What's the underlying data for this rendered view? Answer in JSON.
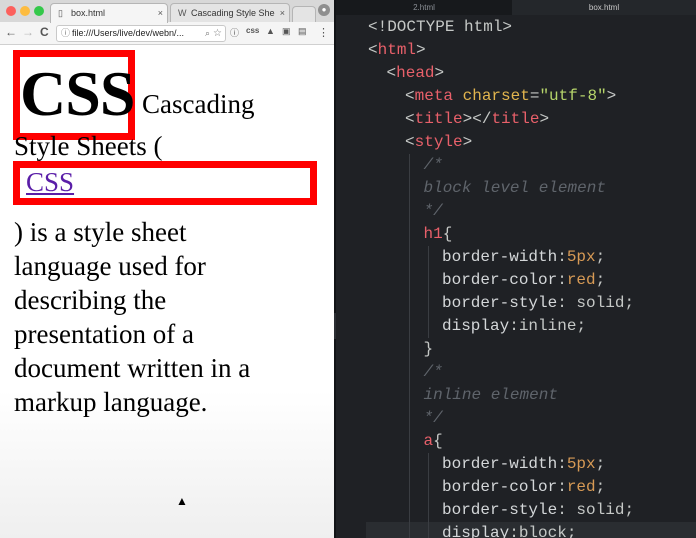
{
  "browser": {
    "tabs": [
      {
        "title": "box.html",
        "icon": "page-icon",
        "active": true
      },
      {
        "title": "Cascading Style Sheets",
        "icon": "wikipedia-icon",
        "active": false
      }
    ],
    "tab_close": "×",
    "url": "file:///Users/live/dev/webn/...",
    "nav": {
      "back": "←",
      "forward": "→",
      "reload": "C"
    },
    "extensions": {
      "info": "ⓘ",
      "css": "css",
      "ext3": "▲",
      "ext4": "▣",
      "ext5": "▤",
      "menu": "⋮"
    }
  },
  "page": {
    "h1": "CSS",
    "line1": "Cascading",
    "line2": "Style Sheets (",
    "link": "CSS",
    "lines": [
      ") is a style sheet",
      "language used for",
      "describing the",
      "presentation of a",
      "document written in a",
      "markup language."
    ]
  },
  "editor": {
    "tabs": [
      "2.html",
      "box.html"
    ],
    "collapse": "›",
    "lines": [
      {
        "indent": 0,
        "tokens": [
          [
            "punc",
            "<!DOCTYPE html>"
          ]
        ]
      },
      {
        "indent": 0,
        "tokens": [
          [
            "punc",
            "<"
          ],
          [
            "tag",
            "html"
          ],
          [
            "punc",
            ">"
          ]
        ]
      },
      {
        "indent": 1,
        "tokens": [
          [
            "punc",
            "<"
          ],
          [
            "tag",
            "head"
          ],
          [
            "punc",
            ">"
          ]
        ]
      },
      {
        "indent": 2,
        "tokens": [
          [
            "punc",
            "<"
          ],
          [
            "tag",
            "meta"
          ],
          [
            "plain",
            " "
          ],
          [
            "attr",
            "charset"
          ],
          [
            "punc",
            "="
          ],
          [
            "str",
            "\"utf-8\""
          ],
          [
            "punc",
            ">"
          ]
        ]
      },
      {
        "indent": 2,
        "tokens": [
          [
            "punc",
            "<"
          ],
          [
            "tag",
            "title"
          ],
          [
            "punc",
            "></"
          ],
          [
            "tag",
            "title"
          ],
          [
            "punc",
            ">"
          ]
        ]
      },
      {
        "indent": 2,
        "tokens": [
          [
            "punc",
            "<"
          ],
          [
            "tag",
            "style"
          ],
          [
            "punc",
            ">"
          ]
        ]
      },
      {
        "indent": 3,
        "tokens": [
          [
            "com",
            "/*"
          ]
        ]
      },
      {
        "indent": 3,
        "tokens": [
          [
            "com",
            "block level element"
          ]
        ]
      },
      {
        "indent": 3,
        "tokens": [
          [
            "com",
            "*/"
          ]
        ]
      },
      {
        "indent": 3,
        "tokens": [
          [
            "sel",
            "h1"
          ],
          [
            "punc",
            "{"
          ]
        ]
      },
      {
        "indent": 4,
        "tokens": [
          [
            "prop",
            "border-width"
          ],
          [
            "punc",
            ":"
          ],
          [
            "val",
            "5px"
          ],
          [
            "punc",
            ";"
          ]
        ]
      },
      {
        "indent": 4,
        "tokens": [
          [
            "prop",
            "border-color"
          ],
          [
            "punc",
            ":"
          ],
          [
            "val",
            "red"
          ],
          [
            "punc",
            ";"
          ]
        ]
      },
      {
        "indent": 4,
        "tokens": [
          [
            "prop",
            "border-style"
          ],
          [
            "punc",
            ": "
          ],
          [
            "plain",
            "solid"
          ],
          [
            "punc",
            ";"
          ]
        ]
      },
      {
        "indent": 4,
        "tokens": [
          [
            "prop",
            "display"
          ],
          [
            "punc",
            ":"
          ],
          [
            "plain",
            "inline"
          ],
          [
            "punc",
            ";"
          ]
        ]
      },
      {
        "indent": 3,
        "tokens": [
          [
            "punc",
            "}"
          ]
        ]
      },
      {
        "indent": 3,
        "tokens": [
          [
            "com",
            "/*"
          ]
        ]
      },
      {
        "indent": 3,
        "tokens": [
          [
            "com",
            "inline element"
          ]
        ]
      },
      {
        "indent": 3,
        "tokens": [
          [
            "com",
            "*/"
          ]
        ]
      },
      {
        "indent": 3,
        "tokens": [
          [
            "sel",
            "a"
          ],
          [
            "punc",
            "{"
          ]
        ]
      },
      {
        "indent": 4,
        "tokens": [
          [
            "prop",
            "border-width"
          ],
          [
            "punc",
            ":"
          ],
          [
            "val",
            "5px"
          ],
          [
            "punc",
            ";"
          ]
        ]
      },
      {
        "indent": 4,
        "tokens": [
          [
            "prop",
            "border-color"
          ],
          [
            "punc",
            ":"
          ],
          [
            "val",
            "red"
          ],
          [
            "punc",
            ";"
          ]
        ]
      },
      {
        "indent": 4,
        "tokens": [
          [
            "prop",
            "border-style"
          ],
          [
            "punc",
            ": "
          ],
          [
            "plain",
            "solid"
          ],
          [
            "punc",
            ";"
          ]
        ]
      },
      {
        "indent": 4,
        "tokens": [
          [
            "prop",
            "display"
          ],
          [
            "punc",
            ":"
          ],
          [
            "plain",
            "block"
          ],
          [
            "punc",
            ";"
          ]
        ]
      }
    ]
  },
  "colors": {
    "border_red": "#ff0000",
    "link_purple": "#5a1ea8",
    "editor_bg": "#1f2125",
    "tag": "#e8606a",
    "attr": "#e2b54e",
    "string": "#b5d46a",
    "value": "#d79a55",
    "comment": "#5f646b"
  }
}
